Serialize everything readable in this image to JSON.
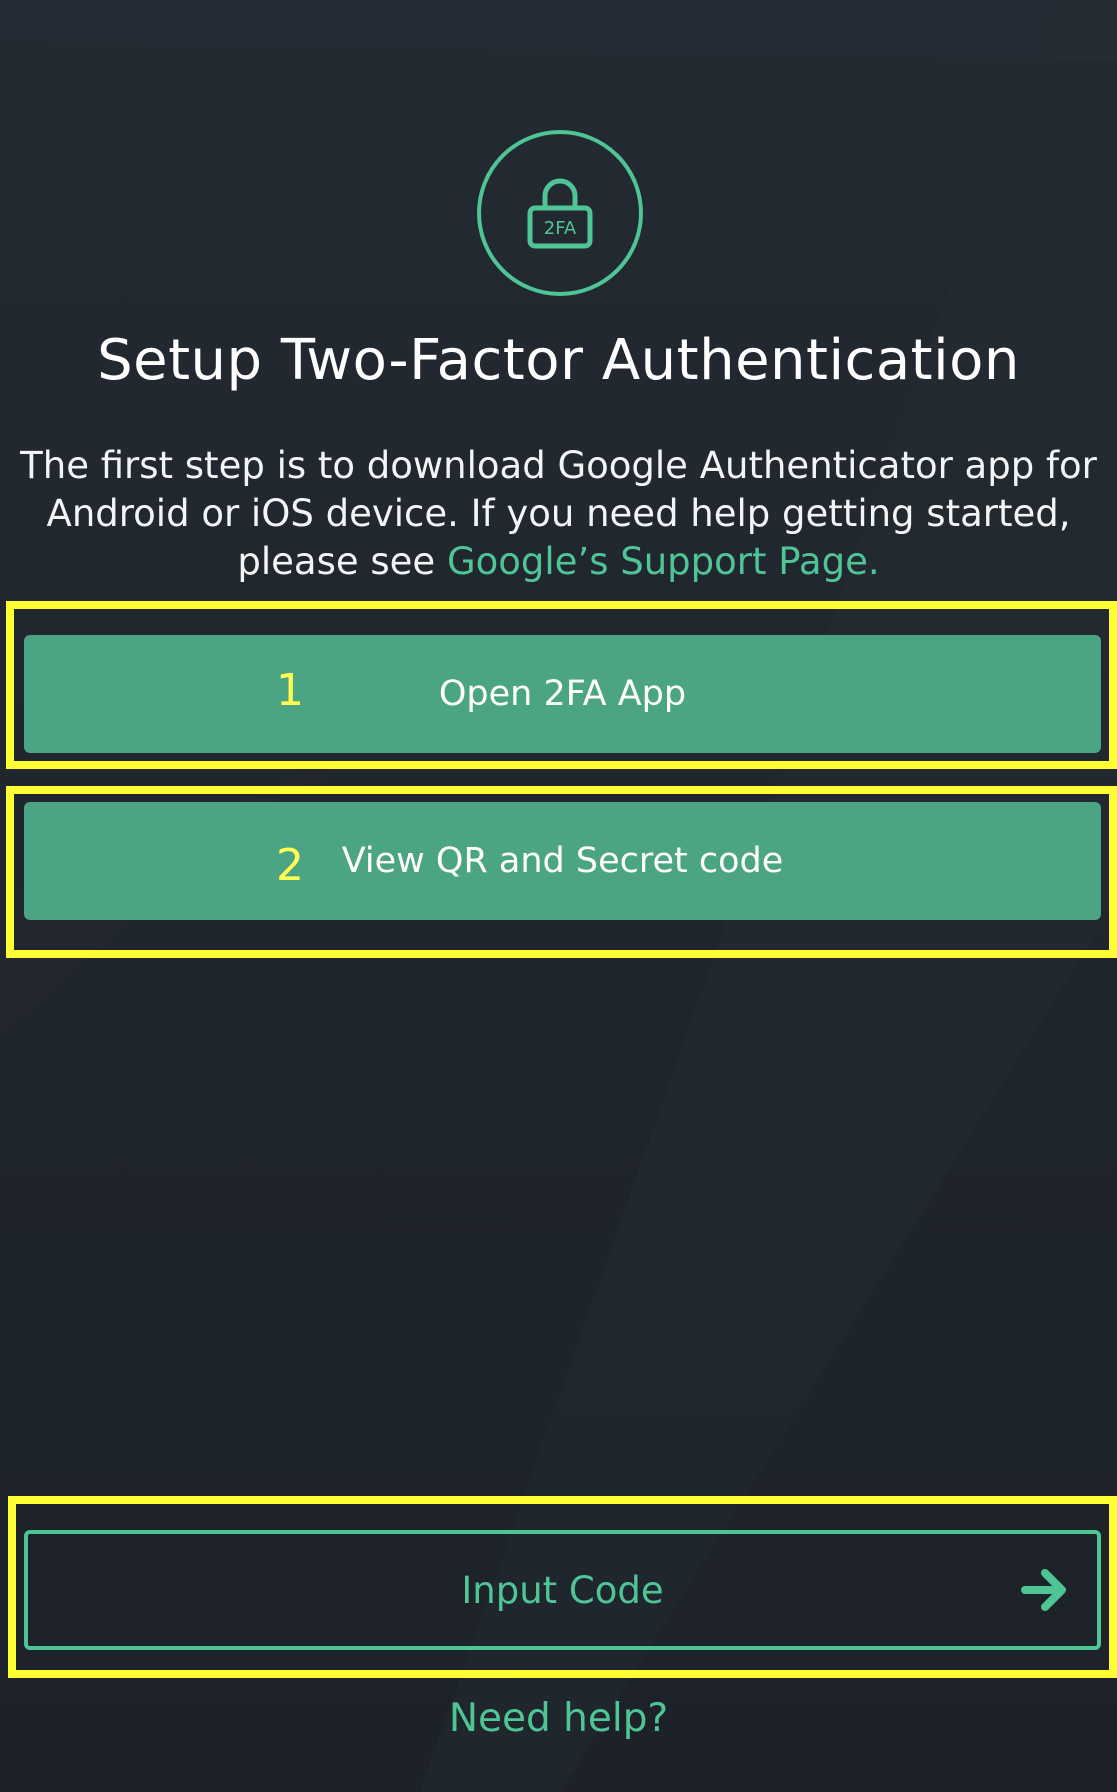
{
  "header": {
    "icon_label": "2FA",
    "title": "Setup Two-Factor Authentication"
  },
  "description": {
    "text": "The first step is to download Google Authenticator app for Android or iOS device. If you need help getting started, please see ",
    "link_text": "Google’s Support Page."
  },
  "steps": [
    {
      "number": "1",
      "label": "Open 2FA App"
    },
    {
      "number": "2",
      "label": "View QR and Secret code"
    }
  ],
  "actions": {
    "input_code_label": "Input Code",
    "need_help_label": "Need help?"
  },
  "colors": {
    "background": "#20262e",
    "accent": "#4fc596",
    "button_fill": "#4ca582",
    "highlight": "#ffff33"
  },
  "icons": {
    "lock": "lock-icon",
    "arrow": "arrow-right-icon"
  }
}
